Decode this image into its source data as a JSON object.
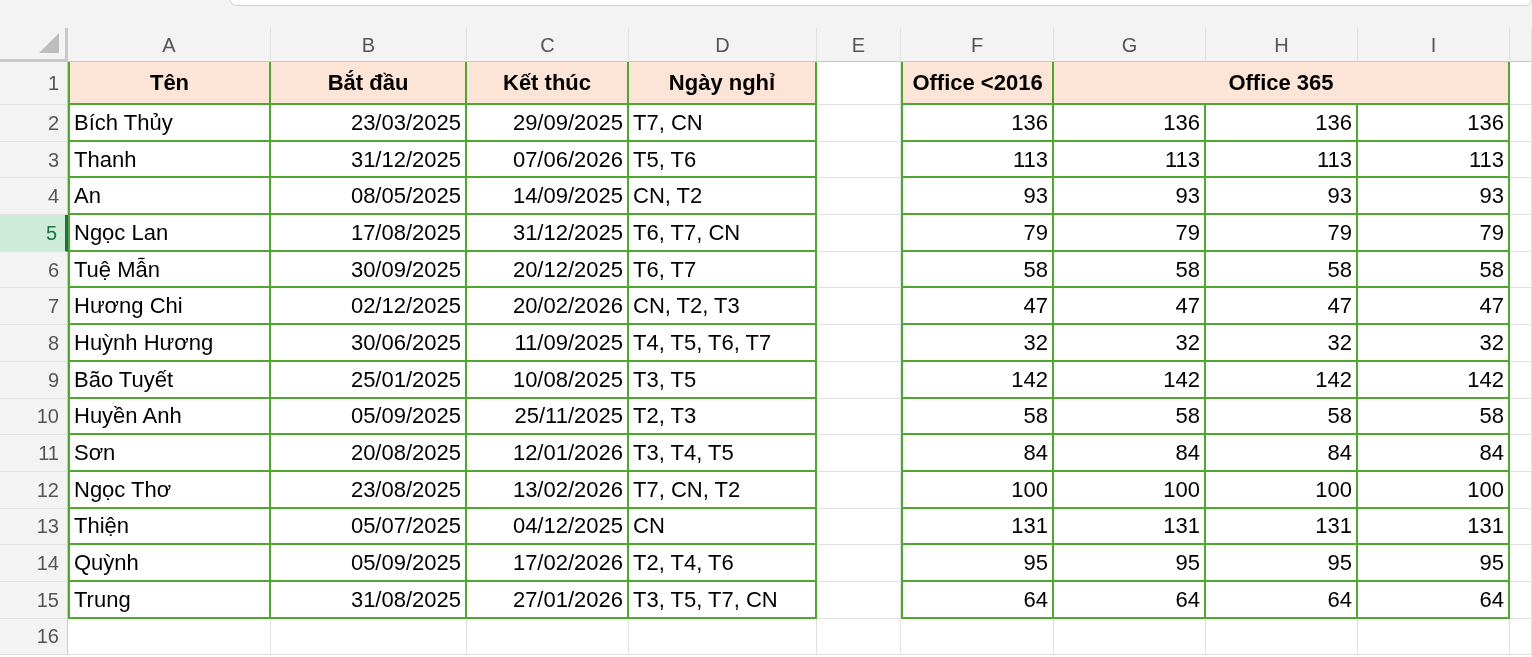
{
  "column_headers": [
    "A",
    "B",
    "C",
    "D",
    "E",
    "F",
    "G",
    "H",
    "I"
  ],
  "row_headers": [
    {
      "label": "1",
      "selected": false
    },
    {
      "label": "2",
      "selected": false
    },
    {
      "label": "3",
      "selected": false
    },
    {
      "label": "4",
      "selected": false
    },
    {
      "label": "5",
      "selected": true
    },
    {
      "label": "6",
      "selected": false
    },
    {
      "label": "7",
      "selected": false
    },
    {
      "label": "8",
      "selected": false
    },
    {
      "label": "9",
      "selected": false
    },
    {
      "label": "10",
      "selected": false
    },
    {
      "label": "11",
      "selected": false
    },
    {
      "label": "12",
      "selected": false
    },
    {
      "label": "13",
      "selected": false
    },
    {
      "label": "14",
      "selected": false
    },
    {
      "label": "15",
      "selected": false
    },
    {
      "label": "16",
      "selected": false
    }
  ],
  "left_table": {
    "columns": [
      "Tên",
      "Bắt đầu",
      "Kết thúc",
      "Ngày nghỉ"
    ],
    "rows": [
      [
        "Bích Thủy",
        "23/03/2025",
        "29/09/2025",
        "T7, CN"
      ],
      [
        "Thanh",
        "31/12/2025",
        "07/06/2026",
        "T5, T6"
      ],
      [
        "An",
        "08/05/2025",
        "14/09/2025",
        "CN, T2"
      ],
      [
        "Ngọc Lan",
        "17/08/2025",
        "31/12/2025",
        "T6, T7, CN"
      ],
      [
        "Tuệ Mẫn",
        "30/09/2025",
        "20/12/2025",
        "T6, T7"
      ],
      [
        "Hương Chi",
        "02/12/2025",
        "20/02/2026",
        "CN, T2, T3"
      ],
      [
        "Huỳnh Hương",
        "30/06/2025",
        "11/09/2025",
        "T4, T5, T6, T7"
      ],
      [
        "Bão Tuyết",
        "25/01/2025",
        "10/08/2025",
        "T3, T5"
      ],
      [
        "Huyền Anh",
        "05/09/2025",
        "25/11/2025",
        "T2, T3"
      ],
      [
        "Sơn",
        "20/08/2025",
        "12/01/2026",
        "T3, T4, T5"
      ],
      [
        "Ngọc Thơ",
        "23/08/2025",
        "13/02/2026",
        "T7, CN, T2"
      ],
      [
        "Thiện",
        "05/07/2025",
        "04/12/2025",
        "CN"
      ],
      [
        "Quỳnh",
        "05/09/2025",
        "17/02/2026",
        "T2, T4, T6"
      ],
      [
        "Trung",
        "31/08/2025",
        "27/01/2026",
        "T3, T5, T7, CN"
      ]
    ]
  },
  "right_table": {
    "headers": [
      {
        "text": "Office <2016"
      },
      {
        "text": "Office 365"
      }
    ],
    "rows": [
      [
        "136",
        "136",
        "136",
        "136"
      ],
      [
        "113",
        "113",
        "113",
        "113"
      ],
      [
        "93",
        "93",
        "93",
        "93"
      ],
      [
        "79",
        "79",
        "79",
        "79"
      ],
      [
        "58",
        "58",
        "58",
        "58"
      ],
      [
        "47",
        "47",
        "47",
        "47"
      ],
      [
        "32",
        "32",
        "32",
        "32"
      ],
      [
        "142",
        "142",
        "142",
        "142"
      ],
      [
        "58",
        "58",
        "58",
        "58"
      ],
      [
        "84",
        "84",
        "84",
        "84"
      ],
      [
        "100",
        "100",
        "100",
        "100"
      ],
      [
        "131",
        "131",
        "131",
        "131"
      ],
      [
        "95",
        "95",
        "95",
        "95"
      ],
      [
        "64",
        "64",
        "64",
        "64"
      ]
    ]
  }
}
